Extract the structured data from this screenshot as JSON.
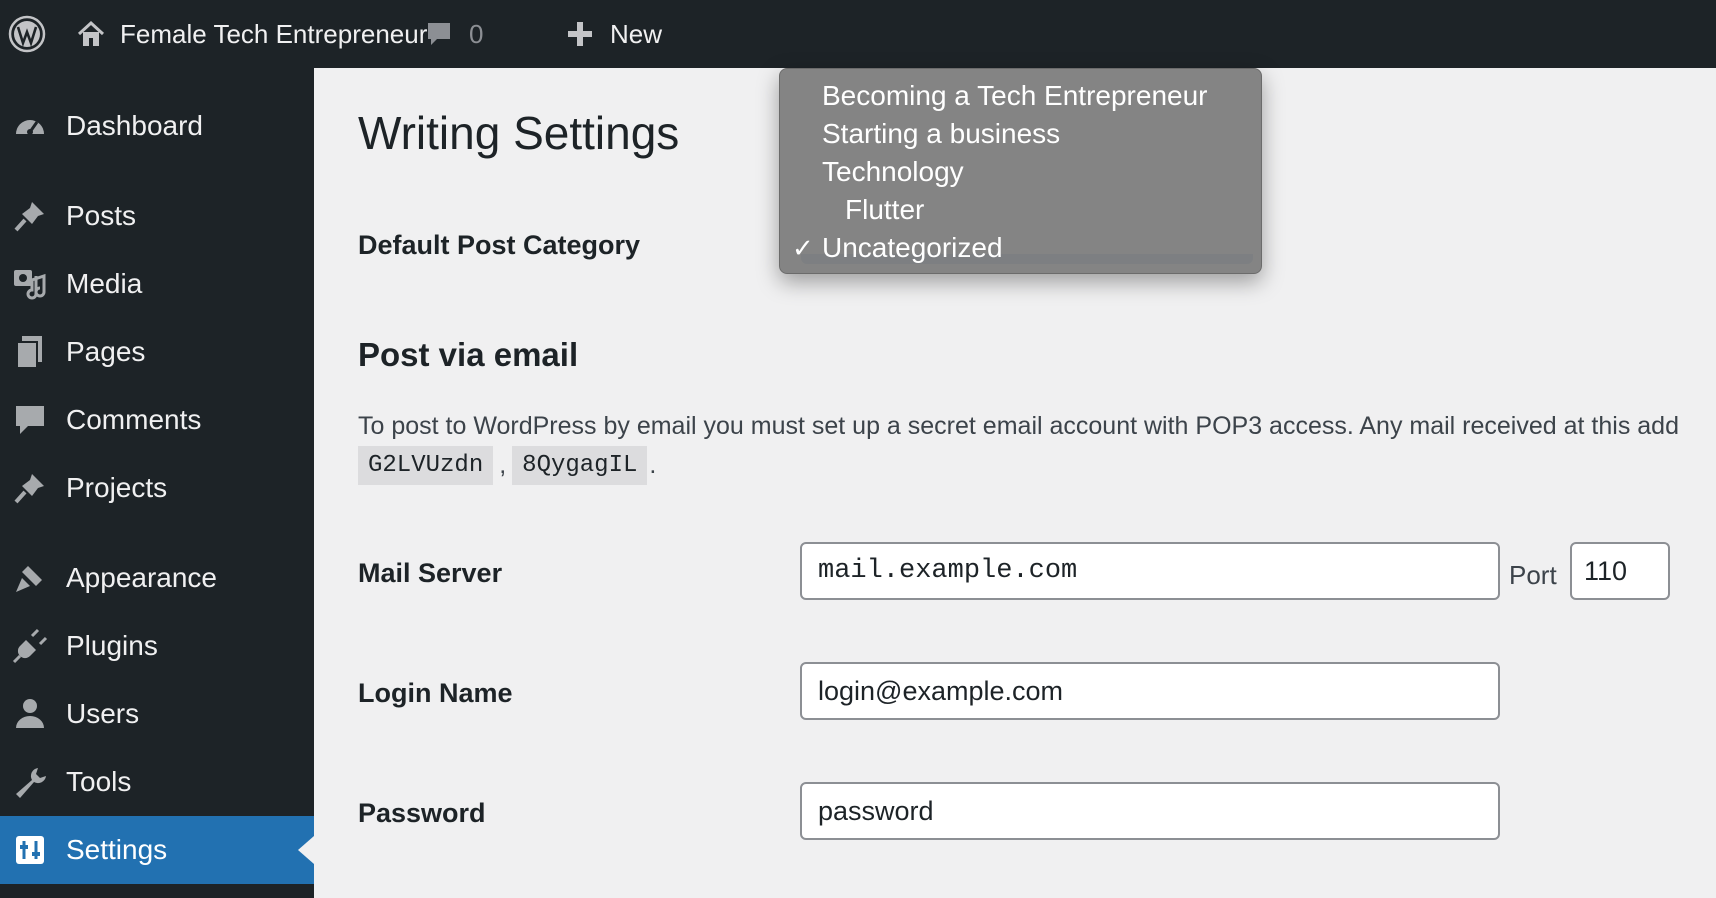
{
  "admin_bar": {
    "site_name": "Female Tech Entrepreneur",
    "comments_count": "0",
    "new_label": "New"
  },
  "sidebar": {
    "items": [
      {
        "label": "Dashboard",
        "icon": "dashboard-icon"
      },
      {
        "label": "Posts",
        "icon": "pin-icon"
      },
      {
        "label": "Media",
        "icon": "media-icon"
      },
      {
        "label": "Pages",
        "icon": "pages-icon"
      },
      {
        "label": "Comments",
        "icon": "comment-icon"
      },
      {
        "label": "Projects",
        "icon": "pin-icon"
      },
      {
        "label": "Appearance",
        "icon": "brush-icon"
      },
      {
        "label": "Plugins",
        "icon": "plug-icon"
      },
      {
        "label": "Users",
        "icon": "user-icon"
      },
      {
        "label": "Tools",
        "icon": "wrench-icon"
      },
      {
        "label": "Settings",
        "icon": "settings-icon",
        "current": true
      }
    ]
  },
  "page": {
    "title": "Writing Settings",
    "default_category_label": "Default Post Category",
    "post_via_email": {
      "title": "Post via email",
      "description": "To post to WordPress by email you must set up a secret email account with POP3 access. Any mail received at this add",
      "codes": [
        "G2LVUzdn",
        "8QygagIL"
      ],
      "code_separator": ",",
      "code_end": "."
    },
    "mail_server": {
      "label": "Mail Server",
      "value": "mail.example.com",
      "port_label": "Port",
      "port_value": "110"
    },
    "login_name": {
      "label": "Login Name",
      "value": "login@example.com"
    },
    "password": {
      "label": "Password",
      "value": "password"
    }
  },
  "category_dropdown": {
    "options": [
      {
        "label": "Becoming a Tech Entrepreneur",
        "selected": false,
        "child": false
      },
      {
        "label": "Starting a business",
        "selected": false,
        "child": false
      },
      {
        "label": "Technology",
        "selected": false,
        "child": false
      },
      {
        "label": "Flutter",
        "selected": false,
        "child": true
      },
      {
        "label": "Uncategorized",
        "selected": true,
        "child": false
      }
    ],
    "check_mark": "✓"
  },
  "colors": {
    "admin_bar_bg": "#1d2327",
    "accent": "#2271b1",
    "page_bg": "#f0f0f1"
  }
}
